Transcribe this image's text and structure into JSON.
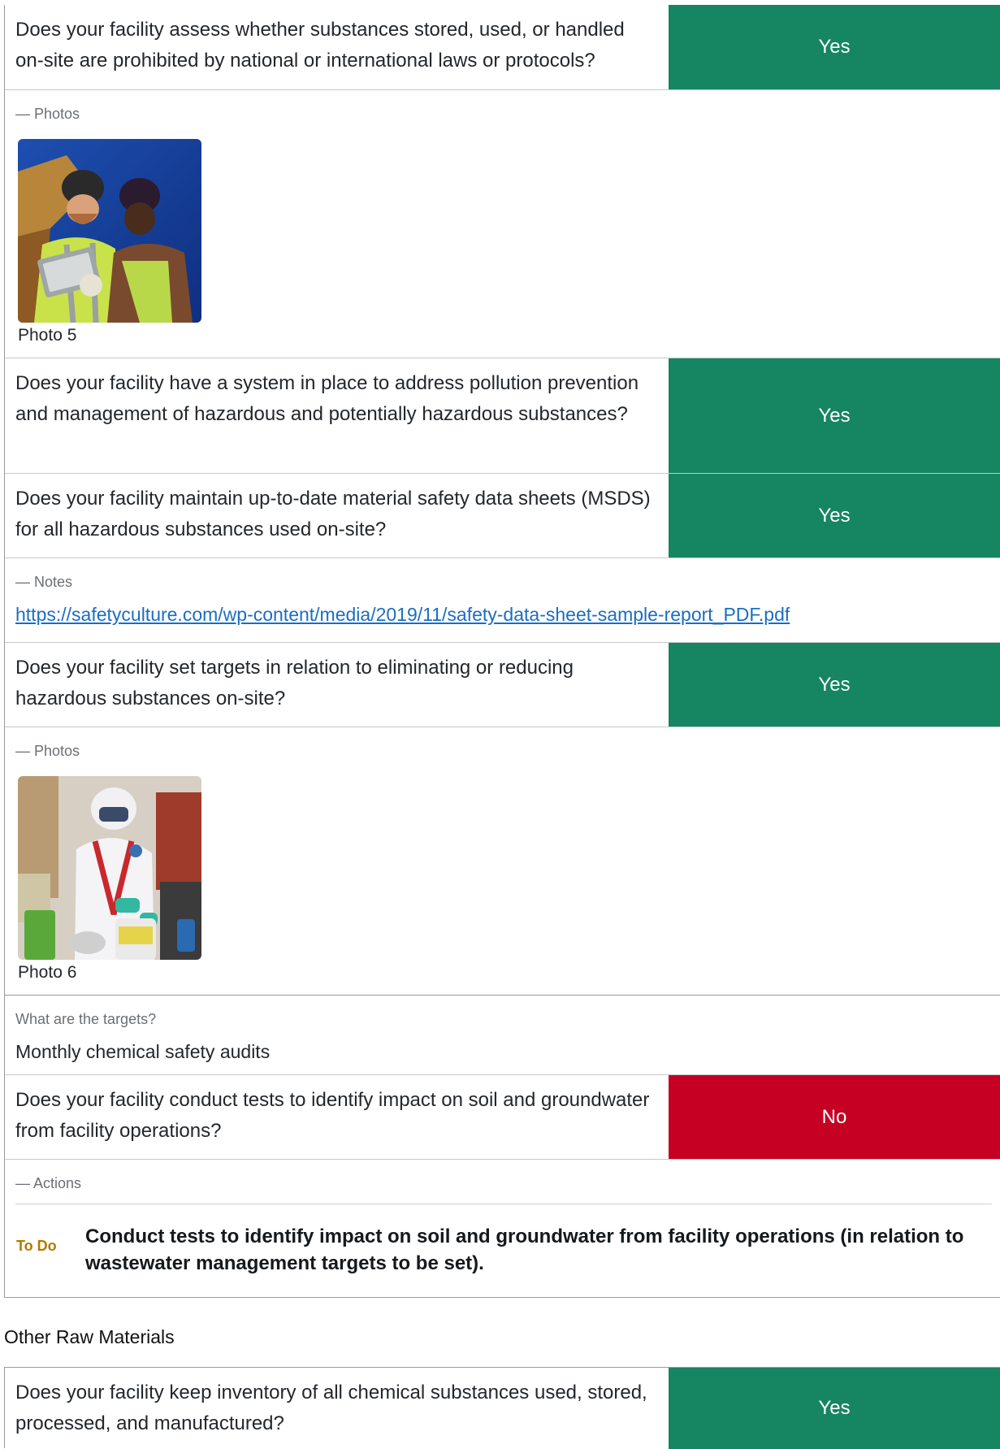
{
  "colors": {
    "yes": "#158562",
    "no": "#c50022",
    "todo": "#b27a00",
    "link": "#1b6ec2"
  },
  "items": [
    {
      "question": "Does your facility assess whether substances stored, used, or handled on-site are prohibited by national or international laws or protocols?",
      "answer": "Yes"
    },
    {
      "question": "Does your facility have a system in place to address pollution prevention and management of hazardous and potentially hazardous substances?",
      "answer": "Yes"
    },
    {
      "question": "Does your facility maintain up-to-date material safety data sheets (MSDS) for all hazardous substances used on-site?",
      "answer": "Yes"
    },
    {
      "question": "Does your facility set targets in relation to eliminating or reducing hazardous substances on-site?",
      "answer": "Yes"
    },
    {
      "question": "Does your facility conduct tests to identify impact on soil and groundwater from facility operations?",
      "answer": "No"
    },
    {
      "question": "Does your facility keep inventory of all chemical substances used, stored, processed, and manufactured?",
      "answer": "Yes"
    }
  ],
  "photos1": {
    "label": "— Photos",
    "caption": "Photo 5"
  },
  "notes": {
    "label": "— Notes",
    "link_text": "https://safetyculture.com/wp-content/media/2019/11/safety-data-sheet-sample-report_PDF.pdf"
  },
  "photos2": {
    "label": "— Photos",
    "caption": "Photo 6"
  },
  "targets": {
    "label": "What are the targets?",
    "value": "Monthly chemical safety audits"
  },
  "actions": {
    "label": "— Actions",
    "status": "To Do",
    "text": "Conduct tests to identify impact on soil and groundwater from facility operations (in relation to wastewater management targets to be set)."
  },
  "section": {
    "title": "Other Raw Materials"
  }
}
